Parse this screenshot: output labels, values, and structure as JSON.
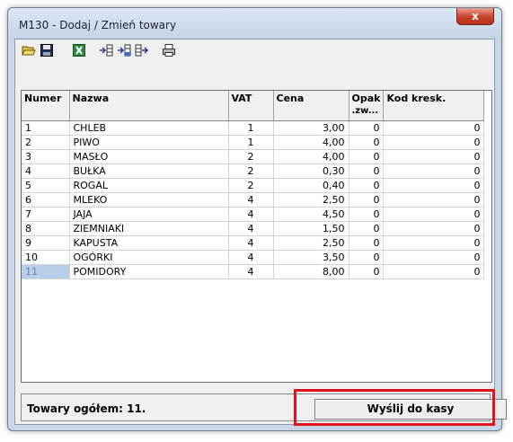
{
  "window": {
    "title": "M130 - Dodaj / Zmień towary",
    "close": "x"
  },
  "table": {
    "headers": {
      "numer": "Numer",
      "nazwa": "Nazwa",
      "vat": "VAT",
      "cena": "Cena",
      "opak1": "Opak",
      "opak2": ".zw...",
      "kod": "Kod kresk."
    },
    "rows": [
      {
        "numer": "1",
        "nazwa": "CHLEB",
        "vat": "1",
        "cena": "3,00",
        "opak": "0",
        "kod": "0"
      },
      {
        "numer": "2",
        "nazwa": "PIWO",
        "vat": "1",
        "cena": "4,00",
        "opak": "0",
        "kod": "0"
      },
      {
        "numer": "3",
        "nazwa": "MASŁO",
        "vat": "2",
        "cena": "4,00",
        "opak": "0",
        "kod": "0"
      },
      {
        "numer": "4",
        "nazwa": "BUŁKA",
        "vat": "2",
        "cena": "0,30",
        "opak": "0",
        "kod": "0"
      },
      {
        "numer": "5",
        "nazwa": "ROGAL",
        "vat": "2",
        "cena": "0,40",
        "opak": "0",
        "kod": "0"
      },
      {
        "numer": "6",
        "nazwa": "MLEKO",
        "vat": "4",
        "cena": "2,50",
        "opak": "0",
        "kod": "0"
      },
      {
        "numer": "7",
        "nazwa": "JAJA",
        "vat": "4",
        "cena": "4,50",
        "opak": "0",
        "kod": "0"
      },
      {
        "numer": "8",
        "nazwa": "ZIEMNIAKI",
        "vat": "4",
        "cena": "1,50",
        "opak": "0",
        "kod": "0"
      },
      {
        "numer": "9",
        "nazwa": "KAPUSTA",
        "vat": "4",
        "cena": "2,50",
        "opak": "0",
        "kod": "0"
      },
      {
        "numer": "10",
        "nazwa": "OGÓRKI",
        "vat": "4",
        "cena": "3,50",
        "opak": "0",
        "kod": "0"
      },
      {
        "numer": "11",
        "nazwa": "POMIDORY",
        "vat": "4",
        "cena": "8,00",
        "opak": "0",
        "kod": "0"
      }
    ]
  },
  "status": {
    "text": "Towary ogółem: 11.",
    "send_button": "Wyślij do kasy"
  },
  "colors": {
    "highlight": "#e2131b",
    "selection": "#b7cde8"
  }
}
